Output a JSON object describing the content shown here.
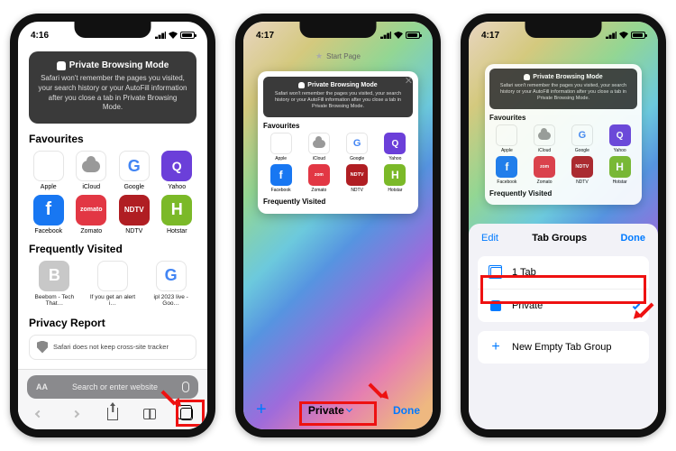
{
  "s1": {
    "time": "4:16",
    "banner_title": "Private Browsing Mode",
    "banner_desc": "Safari won't remember the pages you visited, your search history or your AutoFill information after you close a tab in Private Browsing Mode.",
    "favourites_h": "Favourites",
    "favs": [
      "Apple",
      "iCloud",
      "Google",
      "Yahoo",
      "Facebook",
      "Zomato",
      "NDTV",
      "Hotstar"
    ],
    "freq_h": "Frequently Visited",
    "freq": [
      "Beebom - Tech That…",
      "If you get an alert i…",
      "ipl 2023 live - Goo…"
    ],
    "privacy_h": "Privacy Report",
    "report_text": "Safari does not keep cross-site tracker",
    "search_aa": "AA",
    "search_ph": "Search or enter website"
  },
  "s2": {
    "time": "4:17",
    "thumb_label": "Start Page",
    "new_tab": "+",
    "private": "Private",
    "done": "Done",
    "banner_title": "Private Browsing Mode",
    "banner_desc": "Safari won't remember the pages you visited, your search history or your AutoFill information after you close a tab in Private Browsing Mode.",
    "favourites_h": "Favourites",
    "favs": [
      "Apple",
      "iCloud",
      "Google",
      "Yahoo",
      "Facebook",
      "Zomato",
      "NDTV",
      "Hotstar"
    ],
    "freq_h": "Frequently Visited"
  },
  "s3": {
    "time": "4:17",
    "banner_title": "Private Browsing Mode",
    "banner_desc": "Safari won't remember the pages you visited, your search history or your AutoFill information after you close a tab in Private Browsing Mode.",
    "favourites_h": "Favourites",
    "favs": [
      "Apple",
      "iCloud",
      "Google",
      "Yahoo",
      "Facebook",
      "Zomato",
      "NDTV",
      "Hotstar"
    ],
    "freq_h": "Frequently Visited",
    "sheet_edit": "Edit",
    "sheet_title": "Tab Groups",
    "sheet_done": "Done",
    "row_tabs": "1 Tab",
    "row_private": "Private",
    "row_new": "New Empty Tab Group"
  }
}
